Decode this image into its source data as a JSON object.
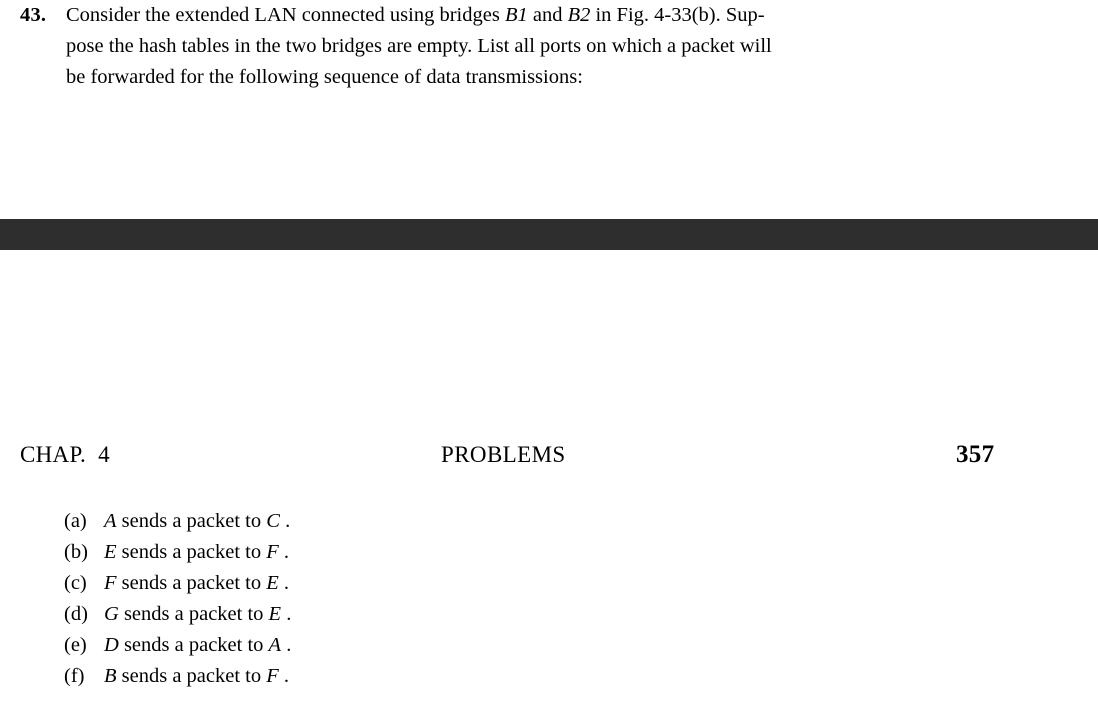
{
  "page": {
    "background_color": "#ffffff",
    "text_color": "#000000",
    "band_color": "#2e2e2e"
  },
  "problem": {
    "number": "43.",
    "line1_a": "Consider the extended LAN connected using bridges ",
    "line1_b1": "B1",
    "line1_c": " and ",
    "line1_b2": "B2",
    "line1_d": " in Fig. 4-33(b). Sup-",
    "line2": "pose the hash tables in the two bridges are empty. List all ports on which a packet will",
    "line3": "be forwarded for the following sequence of data transmissions:"
  },
  "running_head": {
    "chapter": "CHAP.  4",
    "center": "PROBLEMS",
    "page_number": "357"
  },
  "answer_list": [
    {
      "marker": "(a)",
      "sender": "A",
      "mid": " sends a packet to ",
      "receiver": "C",
      "end": " ."
    },
    {
      "marker": "(b)",
      "sender": "E",
      "mid": " sends a packet to ",
      "receiver": "F",
      "end": " ."
    },
    {
      "marker": "(c)",
      "sender": "F",
      "mid": " sends a packet to ",
      "receiver": "E",
      "end": " ."
    },
    {
      "marker": "(d)",
      "sender": "G",
      "mid": " sends a packet to ",
      "receiver": "E",
      "end": " ."
    },
    {
      "marker": "(e)",
      "sender": "D",
      "mid": " sends a packet to ",
      "receiver": "A",
      "end": " ."
    },
    {
      "marker": "(f)",
      "sender": "B",
      "mid": " sends a packet to ",
      "receiver": "F",
      "end": " ."
    }
  ]
}
